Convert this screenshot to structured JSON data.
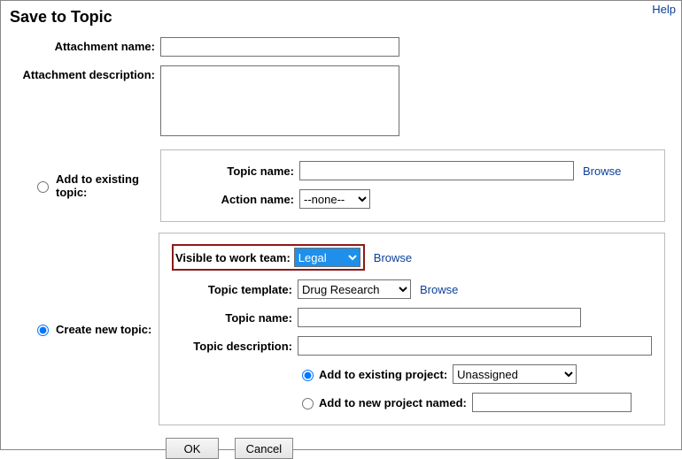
{
  "help": "Help",
  "title": "Save to Topic",
  "attachment_name_label": "Attachment name:",
  "attachment_name_value": "",
  "attachment_desc_label": "Attachment description:",
  "attachment_desc_value": "",
  "existing": {
    "radio_label": "Add to existing topic:",
    "topic_name_label": "Topic name:",
    "topic_name_value": "",
    "browse": "Browse",
    "action_name_label": "Action name:",
    "action_name_value": "--none--"
  },
  "create": {
    "radio_label": "Create new topic:",
    "visible_label": "Visible to work team:",
    "visible_value": "Legal",
    "visible_browse": "Browse",
    "template_label": "Topic template:",
    "template_value": "Drug Research",
    "template_browse": "Browse",
    "topic_name_label": "Topic name:",
    "topic_name_value": "",
    "topic_desc_label": "Topic description:",
    "topic_desc_value": "",
    "add_existing_project_label": "Add to existing project:",
    "add_existing_project_value": "Unassigned",
    "add_new_project_label": "Add to new project named:",
    "add_new_project_value": ""
  },
  "buttons": {
    "ok": "OK",
    "cancel": "Cancel"
  }
}
